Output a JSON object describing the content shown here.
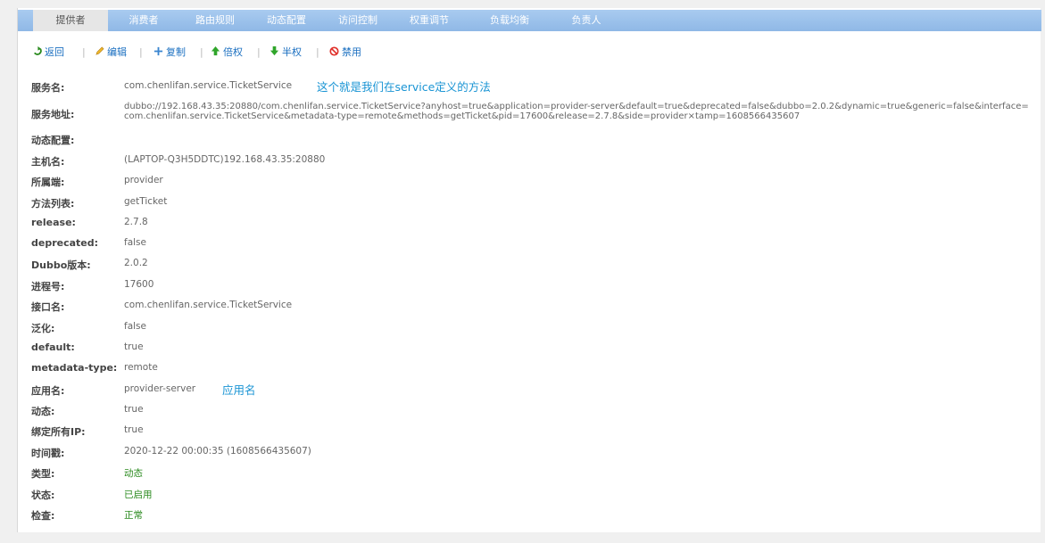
{
  "tabs": [
    {
      "label": "提供者",
      "active": true
    },
    {
      "label": "消费者"
    },
    {
      "label": "路由规则"
    },
    {
      "label": "动态配置"
    },
    {
      "label": "访问控制"
    },
    {
      "label": "权重调节"
    },
    {
      "label": "负载均衡"
    },
    {
      "label": "负责人"
    }
  ],
  "toolbar": {
    "back": "返回",
    "edit": "编辑",
    "copy": "复制",
    "double_weight": "倍权",
    "half_weight": "半权",
    "disable": "禁用",
    "separator": "|"
  },
  "details": {
    "service_name": {
      "label": "服务名:",
      "value": "com.chenlifan.service.TicketService"
    },
    "service_address": {
      "label": "服务地址:",
      "value": "dubbo://192.168.43.35:20880/com.chenlifan.service.TicketService?anyhost=true&application=provider-server&default=true&deprecated=false&dubbo=2.0.2&dynamic=true&generic=false&interface=com.chenlifan.service.TicketService&metadata-type=remote&methods=getTicket&pid=17600&release=2.7.8&side=provider×tamp=1608566435607"
    },
    "dynamic_config": {
      "label": "动态配置:",
      "value": ""
    },
    "host": {
      "label": "主机名:",
      "value": "(LAPTOP-Q3H5DDTC)192.168.43.35:20880"
    },
    "side": {
      "label": "所属端:",
      "value": "provider"
    },
    "methods": {
      "label": "方法列表:",
      "value": "getTicket"
    },
    "release": {
      "label": "release:",
      "value": "2.7.8"
    },
    "deprecated": {
      "label": "deprecated:",
      "value": "false"
    },
    "dubbo_version": {
      "label": "Dubbo版本:",
      "value": "2.0.2"
    },
    "pid": {
      "label": "进程号:",
      "value": "17600"
    },
    "interface": {
      "label": "接口名:",
      "value": "com.chenlifan.service.TicketService"
    },
    "generic": {
      "label": "泛化:",
      "value": "false"
    },
    "default": {
      "label": "default:",
      "value": "true"
    },
    "metadata_type": {
      "label": "metadata-type:",
      "value": "remote"
    },
    "application": {
      "label": "应用名:",
      "value": "provider-server"
    },
    "dynamic": {
      "label": "动态:",
      "value": "true"
    },
    "anyhost": {
      "label": "绑定所有IP:",
      "value": "true"
    },
    "timestamp": {
      "label": "时间戳:",
      "value": "2020-12-22 00:00:35 (1608566435607)"
    },
    "type": {
      "label": "类型:",
      "value": "动态"
    },
    "status": {
      "label": "状态:",
      "value": "已启用"
    },
    "check": {
      "label": "检查:",
      "value": "正常"
    }
  },
  "annotations": {
    "service_note": "这个就是我们在service定义的方法",
    "app_note": "应用名"
  },
  "colors": {
    "tab_bar": "#8fb8e6",
    "link": "#1a6fc0",
    "status_green": "#2a8a1e",
    "annotation": "#1994d4"
  }
}
